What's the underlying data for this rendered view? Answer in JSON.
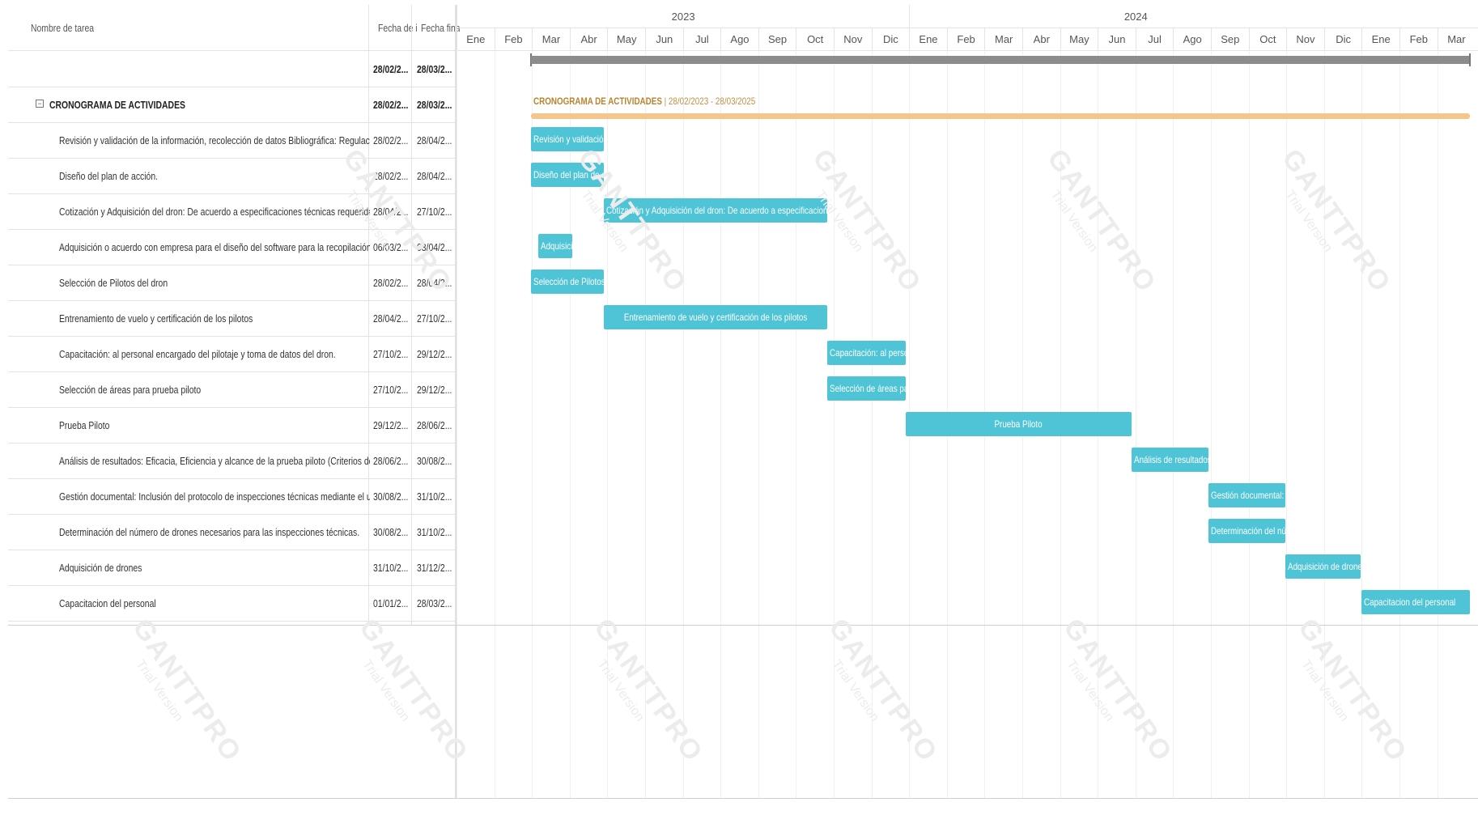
{
  "grid": {
    "columns": {
      "name": "Nombre de tarea",
      "start": "Fecha de in",
      "end": "Fecha final"
    },
    "summary_row": {
      "start": "28/02/2...",
      "end": "28/03/2..."
    },
    "project_row": {
      "name": "CRONOGRAMA DE ACTIVIDADES",
      "start": "28/02/2...",
      "end": "28/03/2..."
    },
    "tasks": [
      {
        "name": "Revisión y validación de la información, recolección de datos Bibliográfica: Regulaciones colom...",
        "start": "28/02/2...",
        "end": "28/04/2..."
      },
      {
        "name": "Diseño del plan de acción.",
        "start": "28/02/2...",
        "end": "28/04/2..."
      },
      {
        "name": "Cotización y Adquisición del dron: De acuerdo a especificaciones técnicas requeridas.",
        "start": "28/04/2...",
        "end": "27/10/2..."
      },
      {
        "name": "Adquisición o acuerdo con empresa para el diseño del software para la recopilación y análisis d...",
        "start": "06/03/2...",
        "end": "03/04/2..."
      },
      {
        "name": "Selección de Pilotos del dron",
        "start": "28/02/2...",
        "end": "28/04/2..."
      },
      {
        "name": "Entrenamiento de vuelo y certificación de los pilotos",
        "start": "28/04/2...",
        "end": "27/10/2..."
      },
      {
        "name": "Capacitación: al personal encargado del pilotaje y toma de datos del dron.",
        "start": "27/10/2...",
        "end": "29/12/2..."
      },
      {
        "name": "Selección de áreas para prueba piloto",
        "start": "27/10/2...",
        "end": "29/12/2..."
      },
      {
        "name": "Prueba Piloto",
        "start": "29/12/2...",
        "end": "28/06/2..."
      },
      {
        "name": "Análisis de resultados: Eficacia, Eficiencia y alcance de la prueba piloto (Criterios de éxito)",
        "start": "28/06/2...",
        "end": "30/08/2..."
      },
      {
        "name": "Gestión documental: Inclusión del protocolo de inspecciones técnicas mediante el uso de dron...",
        "start": "30/08/2...",
        "end": "31/10/2..."
      },
      {
        "name": "Determinación del número de drones necesarios para las inspecciones técnicas.",
        "start": "30/08/2...",
        "end": "31/10/2..."
      },
      {
        "name": "Adquisición de drones",
        "start": "31/10/2...",
        "end": "31/12/2..."
      },
      {
        "name": "Capacitacion del personal",
        "start": "01/01/2...",
        "end": "28/03/2..."
      }
    ]
  },
  "timeline": {
    "years": [
      "2023",
      "2024"
    ],
    "months": [
      "Ene",
      "Feb",
      "Mar",
      "Abr",
      "May",
      "Jun",
      "Jul",
      "Ago",
      "Sep",
      "Oct",
      "Nov",
      "Dic",
      "Ene",
      "Feb",
      "Mar",
      "Abr",
      "May",
      "Jun",
      "Jul",
      "Ago",
      "Sep",
      "Oct",
      "Nov",
      "Dic",
      "Ene",
      "Feb",
      "Mar"
    ],
    "project_label": {
      "name": "CRONOGRAMA DE ACTIVIDADES",
      "range": "28/02/2023 - 28/03/2025"
    },
    "bars": [
      {
        "label": "Revisión y validación...",
        "start": "2023-02-28",
        "end": "2023-04-28"
      },
      {
        "label": "Diseño del plan de a...",
        "start": "2023-02-28",
        "end": "2023-04-28"
      },
      {
        "label": "Cotización y Adquisición del dron: De acuerdo a especificaciones técni...",
        "start": "2023-04-28",
        "end": "2023-10-27"
      },
      {
        "label": "Adquisici...",
        "start": "2023-03-06",
        "end": "2023-04-03"
      },
      {
        "label": "Selección de Pilotos...",
        "start": "2023-02-28",
        "end": "2023-04-28"
      },
      {
        "label": "Entrenamiento de vuelo y certificación de los pilotos",
        "start": "2023-04-28",
        "end": "2023-10-27",
        "centered": true
      },
      {
        "label": "Capacitación: al perso...",
        "start": "2023-10-27",
        "end": "2023-12-29"
      },
      {
        "label": "Selección de áreas par...",
        "start": "2023-10-27",
        "end": "2023-12-29"
      },
      {
        "label": "Prueba Piloto",
        "start": "2023-12-29",
        "end": "2024-06-28",
        "centered": true
      },
      {
        "label": "Análisis de resultados:...",
        "start": "2024-06-28",
        "end": "2024-08-30"
      },
      {
        "label": "Gestión documental: I...",
        "start": "2024-08-30",
        "end": "2024-10-31"
      },
      {
        "label": "Determinación del nú...",
        "start": "2024-08-30",
        "end": "2024-10-31"
      },
      {
        "label": "Adquisición de drones",
        "start": "2024-10-31",
        "end": "2024-12-31"
      },
      {
        "label": "Capacitacion del personal",
        "start": "2025-01-01",
        "end": "2025-03-28"
      }
    ],
    "project_range": {
      "start": "2023-02-28",
      "end": "2025-03-28"
    }
  },
  "watermark": {
    "brand": "GANTTPRO",
    "sub": "Trial Version"
  },
  "colors": {
    "task_bar": "#4ec4d6",
    "project_bar": "#f5c58c",
    "summary_bar": "#8c8c8c",
    "project_label": "#c49042"
  }
}
